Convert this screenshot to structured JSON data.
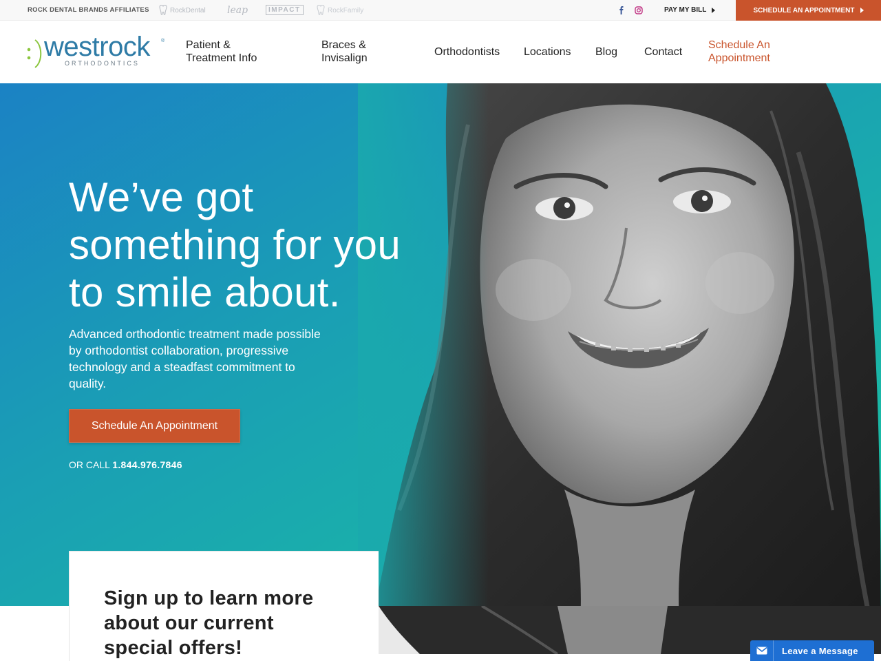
{
  "topbar": {
    "affiliates_label": "ROCK DENTAL BRANDS AFFILIATES",
    "affiliate_logos": [
      "RockDental",
      "leap",
      "IMPACT",
      "RockFamily"
    ],
    "pay_bill": "PAY MY BILL",
    "schedule": "SCHEDULE AN APPOINTMENT",
    "social_icons": [
      "facebook-icon",
      "instagram-icon"
    ]
  },
  "header": {
    "logo_word": "westrock",
    "logo_sub": "ORTHODONTICS",
    "nav": {
      "patient_line1": "Patient &",
      "patient_line2": "Treatment Info",
      "braces_line1": "Braces &",
      "braces_line2": "Invisalign",
      "orthodontists": "Orthodontists",
      "locations": "Locations",
      "blog": "Blog",
      "contact": "Contact",
      "schedule_line1": "Schedule An",
      "schedule_line2": "Appointment"
    }
  },
  "hero": {
    "title_line1": "We’ve got",
    "title_line2": "something for you",
    "title_line3": "to smile about.",
    "text_line1": "Advanced orthodontic treatment made possible",
    "text_line2": "by orthodontist collaboration, progressive",
    "text_line3": "technology and a steadfast commitment to",
    "text_line4": "quality.",
    "button": "Schedule An Appointment",
    "call_prefix": "OR CALL",
    "phone": "1.844.976.7846"
  },
  "signup": {
    "line1": "Sign up to learn more",
    "line2": "about our current",
    "line3": "special offers!"
  },
  "chat": {
    "label": "Leave a Message",
    "icon": "envelope-icon"
  },
  "colors": {
    "accent": "#c9542c",
    "brand_blue": "#2e7ba6",
    "gradient_start": "#1b82c4",
    "gradient_end": "#19c3a0",
    "chat_blue": "#1e6fd3"
  }
}
